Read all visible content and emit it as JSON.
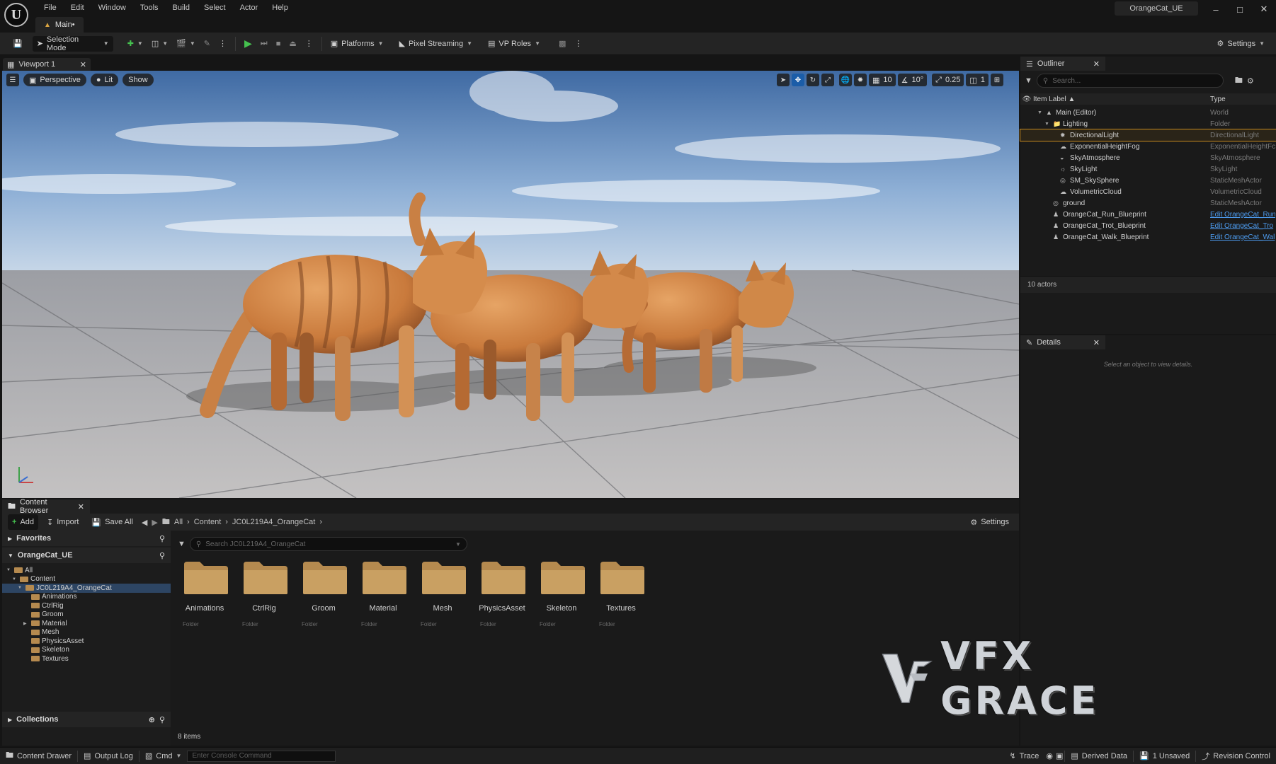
{
  "app": {
    "project_name": "OrangeCat_UE",
    "level_tab": "Main•",
    "logo_text": "U"
  },
  "menu": [
    "File",
    "Edit",
    "Window",
    "Tools",
    "Build",
    "Select",
    "Actor",
    "Help"
  ],
  "toolbar": {
    "selection_mode": "Selection Mode",
    "platforms": "Platforms",
    "pixel_streaming": "Pixel Streaming",
    "vp_roles": "VP Roles",
    "settings": "Settings"
  },
  "viewport": {
    "tab_label": "Viewport 1",
    "perspective": "Perspective",
    "lit": "Lit",
    "show": "Show",
    "grid_snap": "10",
    "rotation_snap": "10°",
    "scale_snap": "0.25",
    "camera_speed": "1",
    "axis_z": "Z",
    "axis_x": "X"
  },
  "outliner": {
    "tab_label": "Outliner",
    "search_placeholder": "Search...",
    "col_label": "Item Label ▲",
    "col_type": "Type",
    "actor_count": "10 actors",
    "rows": [
      {
        "label": "Main (Editor)",
        "type": "World",
        "link": false
      },
      {
        "label": "Lighting",
        "type": "Folder",
        "link": false
      },
      {
        "label": "DirectionalLight",
        "type": "DirectionalLight",
        "link": false
      },
      {
        "label": "ExponentialHeightFog",
        "type": "ExponentialHeightFc",
        "link": false
      },
      {
        "label": "SkyAtmosphere",
        "type": "SkyAtmosphere",
        "link": false
      },
      {
        "label": "SkyLight",
        "type": "SkyLight",
        "link": false
      },
      {
        "label": "SM_SkySphere",
        "type": "StaticMeshActor",
        "link": false
      },
      {
        "label": "VolumetricCloud",
        "type": "VolumetricCloud",
        "link": false
      },
      {
        "label": "ground",
        "type": "StaticMeshActor",
        "link": false
      },
      {
        "label": "OrangeCat_Run_Blueprint",
        "type": "Edit OrangeCat_Run",
        "link": true
      },
      {
        "label": "OrangeCat_Trot_Blueprint",
        "type": "Edit OrangeCat_Tro",
        "link": true
      },
      {
        "label": "OrangeCat_Walk_Blueprint",
        "type": "Edit OrangeCat_Wal",
        "link": true
      }
    ]
  },
  "details": {
    "tab_label": "Details",
    "empty_hint": "Select an object to view details."
  },
  "content_browser": {
    "tab_label": "Content Browser",
    "add": "Add",
    "import": "Import",
    "save_all": "Save All",
    "breadcrumb": [
      "All",
      "Content",
      "JC0L219A4_OrangeCat"
    ],
    "settings": "Settings",
    "favorites": "Favorites",
    "project_root": "OrangeCat_UE",
    "search_placeholder": "Search JC0L219A4_OrangeCat",
    "tree": [
      {
        "label": "All",
        "depth": 0,
        "expander": "▼"
      },
      {
        "label": "Content",
        "depth": 1,
        "expander": "▼"
      },
      {
        "label": "JC0L219A4_OrangeCat",
        "depth": 2,
        "expander": "▼"
      },
      {
        "label": "Animations",
        "depth": 3,
        "expander": ""
      },
      {
        "label": "CtrlRig",
        "depth": 3,
        "expander": ""
      },
      {
        "label": "Groom",
        "depth": 3,
        "expander": ""
      },
      {
        "label": "Material",
        "depth": 3,
        "expander": "▶"
      },
      {
        "label": "Mesh",
        "depth": 3,
        "expander": ""
      },
      {
        "label": "PhysicsAsset",
        "depth": 3,
        "expander": ""
      },
      {
        "label": "Skeleton",
        "depth": 3,
        "expander": ""
      },
      {
        "label": "Textures",
        "depth": 3,
        "expander": ""
      }
    ],
    "folders": [
      "Animations",
      "CtrlRig",
      "Groom",
      "Material",
      "Mesh",
      "PhysicsAsset",
      "Skeleton",
      "Textures"
    ],
    "folder_type_label": "Folder",
    "collections": "Collections",
    "item_count": "8 items"
  },
  "watermark": {
    "text": "VFX GRACE"
  },
  "statusbar": {
    "content_drawer": "Content Drawer",
    "output_log": "Output Log",
    "cmd": "Cmd",
    "console_placeholder": "Enter Console Command",
    "trace": "Trace",
    "derived_data": "Derived Data",
    "unsaved": "1 Unsaved",
    "revision_control": "Revision Control"
  },
  "colors": {
    "accent_blue": "#1b5da8",
    "selection_orange": "#c88a1e",
    "folder": "#b58a4f",
    "play_green": "#45c14f"
  }
}
